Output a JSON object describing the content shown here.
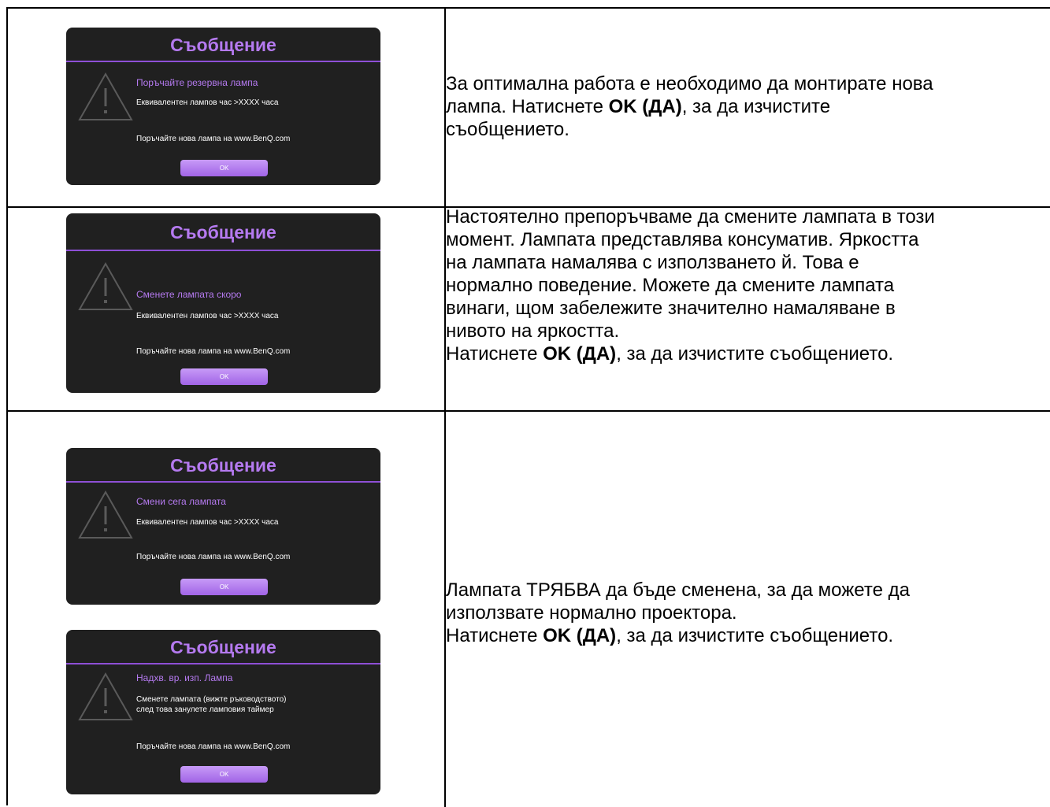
{
  "dialogs": [
    {
      "title": "Съобщение",
      "subtitle": "Поръчайте резервна лампа",
      "info": "Еквивалентен лампов час >XXXX часа",
      "order": "Поръчайте нова лампа на www.BenQ.com",
      "ok": "OK"
    },
    {
      "title": "Съобщение",
      "subtitle": "Сменете лампата скоро",
      "info": "Еквивалентен лампов час >XXXX часа",
      "order": "Поръчайте нова лампа на www.BenQ.com",
      "ok": "OK"
    },
    {
      "title": "Съобщение",
      "subtitle": "Смени сега лампата",
      "info": "Еквивалентен лампов час >XXXX часа",
      "order": "Поръчайте нова лампа на www.BenQ.com",
      "ok": "OK"
    },
    {
      "title": "Съобщение",
      "subtitle": "Надхв. вр. изп. Лампа",
      "info_line1": "Сменете лампата (вижте ръководството)",
      "info_line2": "след това занулете лампов​ия таймер",
      "order": "Поръчайте нова лампа на www.BenQ.com",
      "ok": "OK"
    }
  ],
  "rows": [
    {
      "text_lines": [
        "За оптимална работа е необходимо да монтирате нова",
        "лампа. Натиснете ",
        "съобщението."
      ],
      "bold": "OK (ДА)",
      "after_bold": ", за да изчистите"
    },
    {
      "lines": [
        "Настоятелно препоръчваме да смените лампата в този",
        "момент. Лампата представлява консуматив. Яркостта",
        "на лампата намалява с използването й. Това е",
        "нормално поведение. Можете да смените лампата",
        "винаги, щом забележите значително намаляване в",
        "нивото на яркостта."
      ],
      "press_prefix": "Натиснете ",
      "bold": "OK (ДА)",
      "press_suffix": ", за да изчистите съобщението."
    },
    {
      "lines": [
        "Лампата ТРЯБВА да бъде сменена, за да можете да",
        "използвате нормално проектора."
      ],
      "press_prefix": "Натиснете ",
      "bold": "OK (ДА)",
      "press_suffix": ", за да изчистите съобщението."
    }
  ],
  "colors": {
    "osd_bg": "#202020",
    "osd_accent": "#b57af0",
    "ok_button": "#a164e6"
  }
}
